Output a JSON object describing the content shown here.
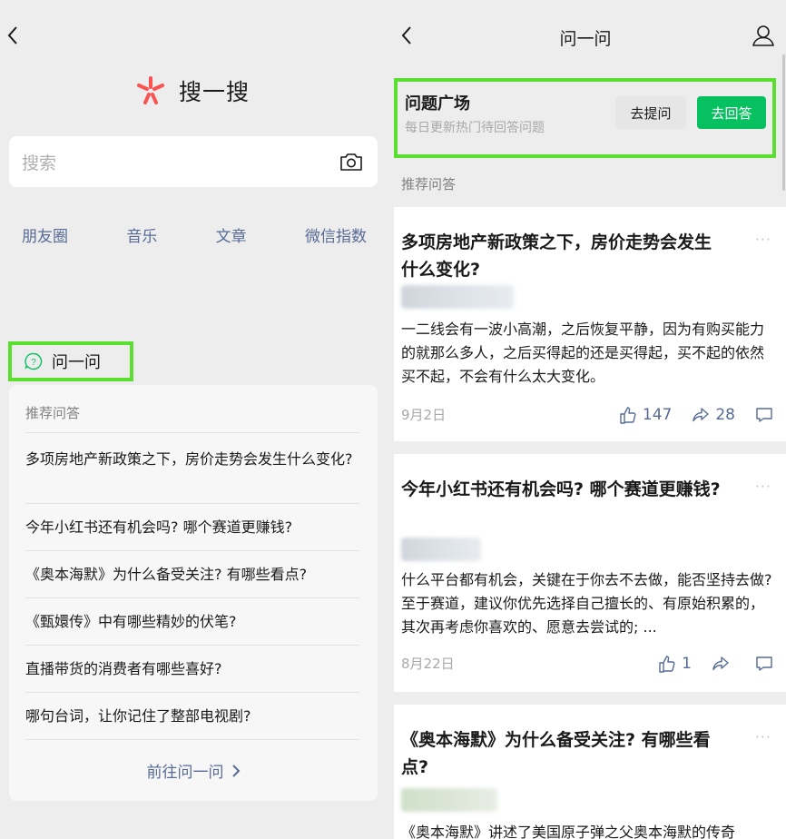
{
  "left": {
    "logo_title": "搜一搜",
    "search_placeholder": "搜索",
    "categories": [
      "朋友圈",
      "音乐",
      "文章",
      "微信指数"
    ],
    "ask_label": "问一问",
    "rec_label": "推荐问答",
    "questions": [
      "多项房地产新政策之下，房价走势会发生什么变化?",
      "今年小红书还有机会吗? 哪个赛道更赚钱?",
      "《奥本海默》为什么备受关注? 有哪些看点?",
      "《甄嬛传》中有哪些精妙的伏笔?",
      "直播带货的消费者有哪些喜好?",
      "哪句台词，让你记住了整部电视剧?"
    ],
    "more_label": "前往问一问"
  },
  "right": {
    "title": "问一问",
    "square": {
      "title": "问题广场",
      "subtitle": "每日更新热门待回答问题",
      "ask_btn": "去提问",
      "answer_btn": "去回答"
    },
    "rec_label": "推荐问答",
    "cards": [
      {
        "title": "多项房地产新政策之下，房价走势会发生什么变化?",
        "body": "一二线会有一波小高潮，之后恢复平静，因为有购买能力的就那么多人，之后买得起的还是买得起，买不起的依然买不起，不会有什么太大变化。",
        "date": "9月2日",
        "likes": "147",
        "shares": "28"
      },
      {
        "title": "今年小红书还有机会吗? 哪个赛道更赚钱?",
        "body": "什么平台都有机会，关键在于你去不去做，能否坚持去做? 至于赛道，建议你优先选择自己擅长的、有原始积累的，其次再考虑你喜欢的、愿意去尝试的; ...",
        "date": "8月22日",
        "likes": "1",
        "shares": ""
      },
      {
        "title": "《奥本海默》为什么备受关注? 有哪些看点?",
        "body": "《奥本海默》讲述了美国原子弹之父奥本海默的传奇",
        "date": "",
        "likes": "",
        "shares": ""
      }
    ],
    "more_dots": "···"
  },
  "colors": {
    "highlight": "#5ade2f",
    "link": "#576b95",
    "primary": "#07c160"
  }
}
